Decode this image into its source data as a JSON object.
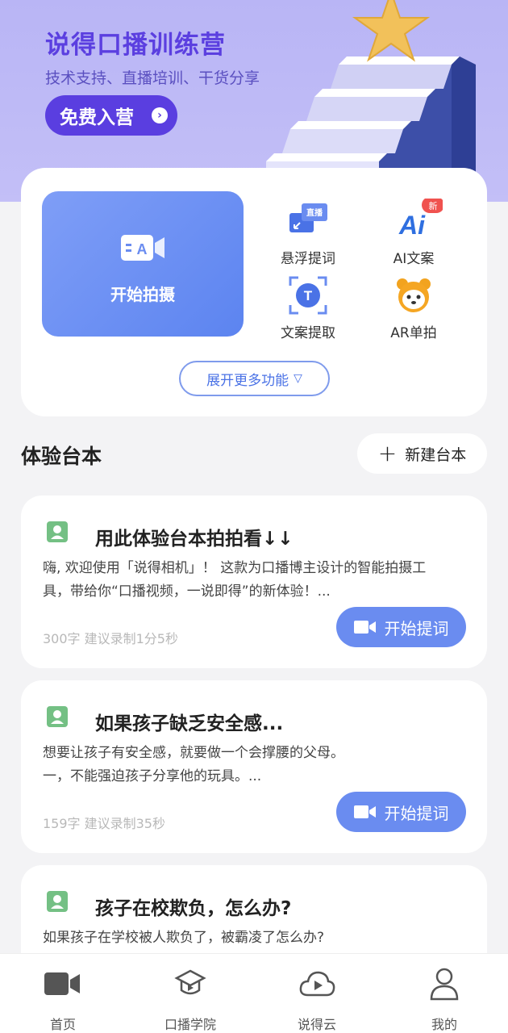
{
  "banner": {
    "title": "说得口播训练营",
    "subtitle": "技术支持、直播培训、干货分享",
    "join_button": "免费入营"
  },
  "features": {
    "primary": "开始拍摄",
    "items": [
      {
        "label": "悬浮提词",
        "icon": "live-float-icon",
        "badge": "直播"
      },
      {
        "label": "AI文案",
        "icon": "ai-icon",
        "badge": "新"
      },
      {
        "label": "文案提取",
        "icon": "text-extract-icon",
        "badge": "T"
      },
      {
        "label": "AR单拍",
        "icon": "panda-icon"
      }
    ],
    "expand_label": "展开更多功能"
  },
  "section": {
    "title": "体验台本",
    "new_button": "新建台本"
  },
  "scripts": [
    {
      "title": "用此体验台本拍拍看↓↓",
      "line1": "嗨, 欢迎使用「说得相机」！ 这款为口播博主设计的智能拍摄工",
      "line2": "具，带给你“口播视频，一说即得”的新体验！...",
      "meta": "300字  建议录制1分5秒",
      "button": "开始提词"
    },
    {
      "title": "如果孩子缺乏安全感...",
      "line1": "想要让孩子有安全感，就要做一个会撑腰的父母。",
      "line2": "一，不能强迫孩子分享他的玩具。...",
      "meta": "159字  建议录制35秒",
      "button": "开始提词"
    },
    {
      "title": "孩子在校欺负，怎么办?",
      "line1": "如果孩子在学校被人欺负了，被霸凌了怎么办?",
      "line2": ""
    }
  ],
  "nav": [
    {
      "label": "首页",
      "icon": "video-camera-icon"
    },
    {
      "label": "口播学院",
      "icon": "graduation-cap-icon"
    },
    {
      "label": "说得云",
      "icon": "cloud-play-icon"
    },
    {
      "label": "我的",
      "icon": "user-icon"
    }
  ],
  "colors": {
    "accent": "#6a8cf0",
    "banner_bg": "#b9b5f5",
    "join_button": "#5a3ee0",
    "badge_red": "#f0524f"
  }
}
